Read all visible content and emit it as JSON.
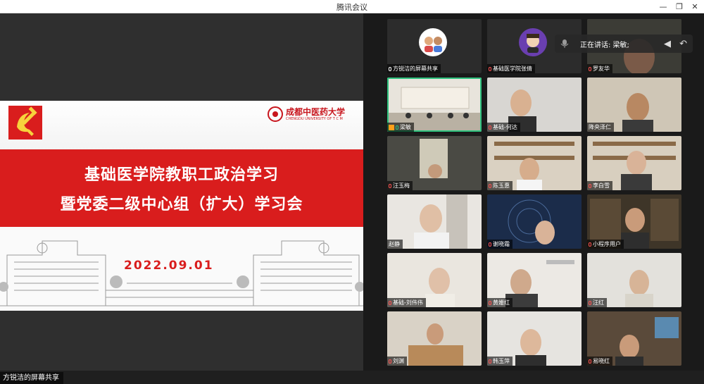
{
  "window": {
    "title": "腾讯会议"
  },
  "share": {
    "label": "方锐洁的屏幕共享",
    "slide": {
      "university_cn": "成都中医药大学",
      "university_en": "CHENGDU UNIVERSITY OF T C M",
      "title_line1": "基础医学院教职工政治学习",
      "title_line2": "暨党委二级中心组（扩大）学习会",
      "date": "2022.09.01"
    }
  },
  "speaker": {
    "text": "正在讲话: 梁敏;"
  },
  "participants": [
    {
      "name": "方锐洁的屏幕共享",
      "type": "avatar"
    },
    {
      "name": "基础医学院张倩",
      "type": "avatar"
    },
    {
      "name": "罗友华",
      "type": "video"
    },
    {
      "name": "梁敏",
      "type": "video",
      "active": true
    },
    {
      "name": "基础-何达",
      "type": "video"
    },
    {
      "name": "降央泽仁",
      "type": "video"
    },
    {
      "name": "汪玉梅",
      "type": "video"
    },
    {
      "name": "陈玉惠",
      "type": "video"
    },
    {
      "name": "李白雪",
      "type": "video"
    },
    {
      "name": "赵静",
      "type": "video"
    },
    {
      "name": "谢晓霜",
      "type": "video"
    },
    {
      "name": "小程序用户",
      "type": "video"
    },
    {
      "name": "基础-刘伟伟",
      "type": "video"
    },
    {
      "name": "黄姗红",
      "type": "video"
    },
    {
      "name": "汪红",
      "type": "video"
    },
    {
      "name": "刘渊",
      "type": "video"
    },
    {
      "name": "韩玉萍",
      "type": "video"
    },
    {
      "name": "易晓红",
      "type": "video"
    }
  ],
  "colors": {
    "accent": "#d91d1d",
    "active_border": "#2ec27e"
  }
}
